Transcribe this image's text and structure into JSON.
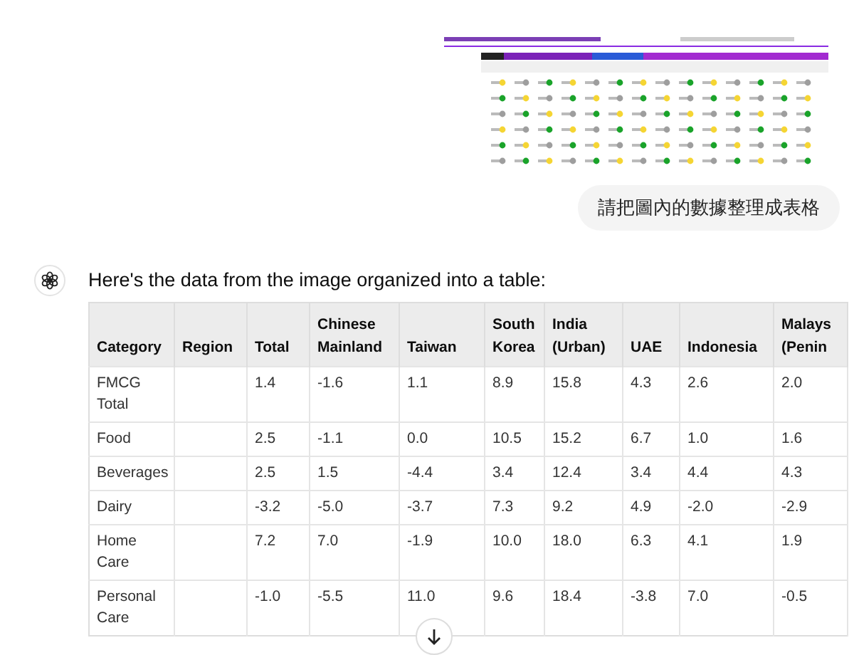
{
  "user_message": {
    "text": "請把圖內的數據整理成表格"
  },
  "assistant_message": {
    "intro": "Here's the data from the image organized into a table:",
    "table": {
      "columns": [
        "Category",
        "Region",
        "Total",
        "Chinese Mainland",
        "Taiwan",
        "South Korea",
        "India (Urban)",
        "UAE",
        "Indonesia",
        "Malays (Penin"
      ],
      "rows": [
        [
          "FMCG Total",
          "",
          "1.4",
          "-1.6",
          "1.1",
          "8.9",
          "15.8",
          "4.3",
          "2.6",
          "2.0"
        ],
        [
          "Food",
          "",
          "2.5",
          "-1.1",
          "0.0",
          "10.5",
          "15.2",
          "6.7",
          "1.0",
          "1.6"
        ],
        [
          "Beverages",
          "",
          "2.5",
          "1.5",
          "-4.4",
          "3.4",
          "12.4",
          "3.4",
          "4.4",
          "4.3"
        ],
        [
          "Dairy",
          "",
          "-3.2",
          "-5.0",
          "-3.7",
          "7.3",
          "9.2",
          "4.9",
          "-2.0",
          "-2.9"
        ],
        [
          "Home Care",
          "",
          "7.2",
          "7.0",
          "-1.9",
          "10.0",
          "18.0",
          "6.3",
          "4.1",
          "1.9"
        ],
        [
          "Personal Care",
          "",
          "-1.0",
          "-5.5",
          "11.0",
          "9.6",
          "18.4",
          "-3.8",
          "7.0",
          "-0.5"
        ]
      ]
    }
  }
}
